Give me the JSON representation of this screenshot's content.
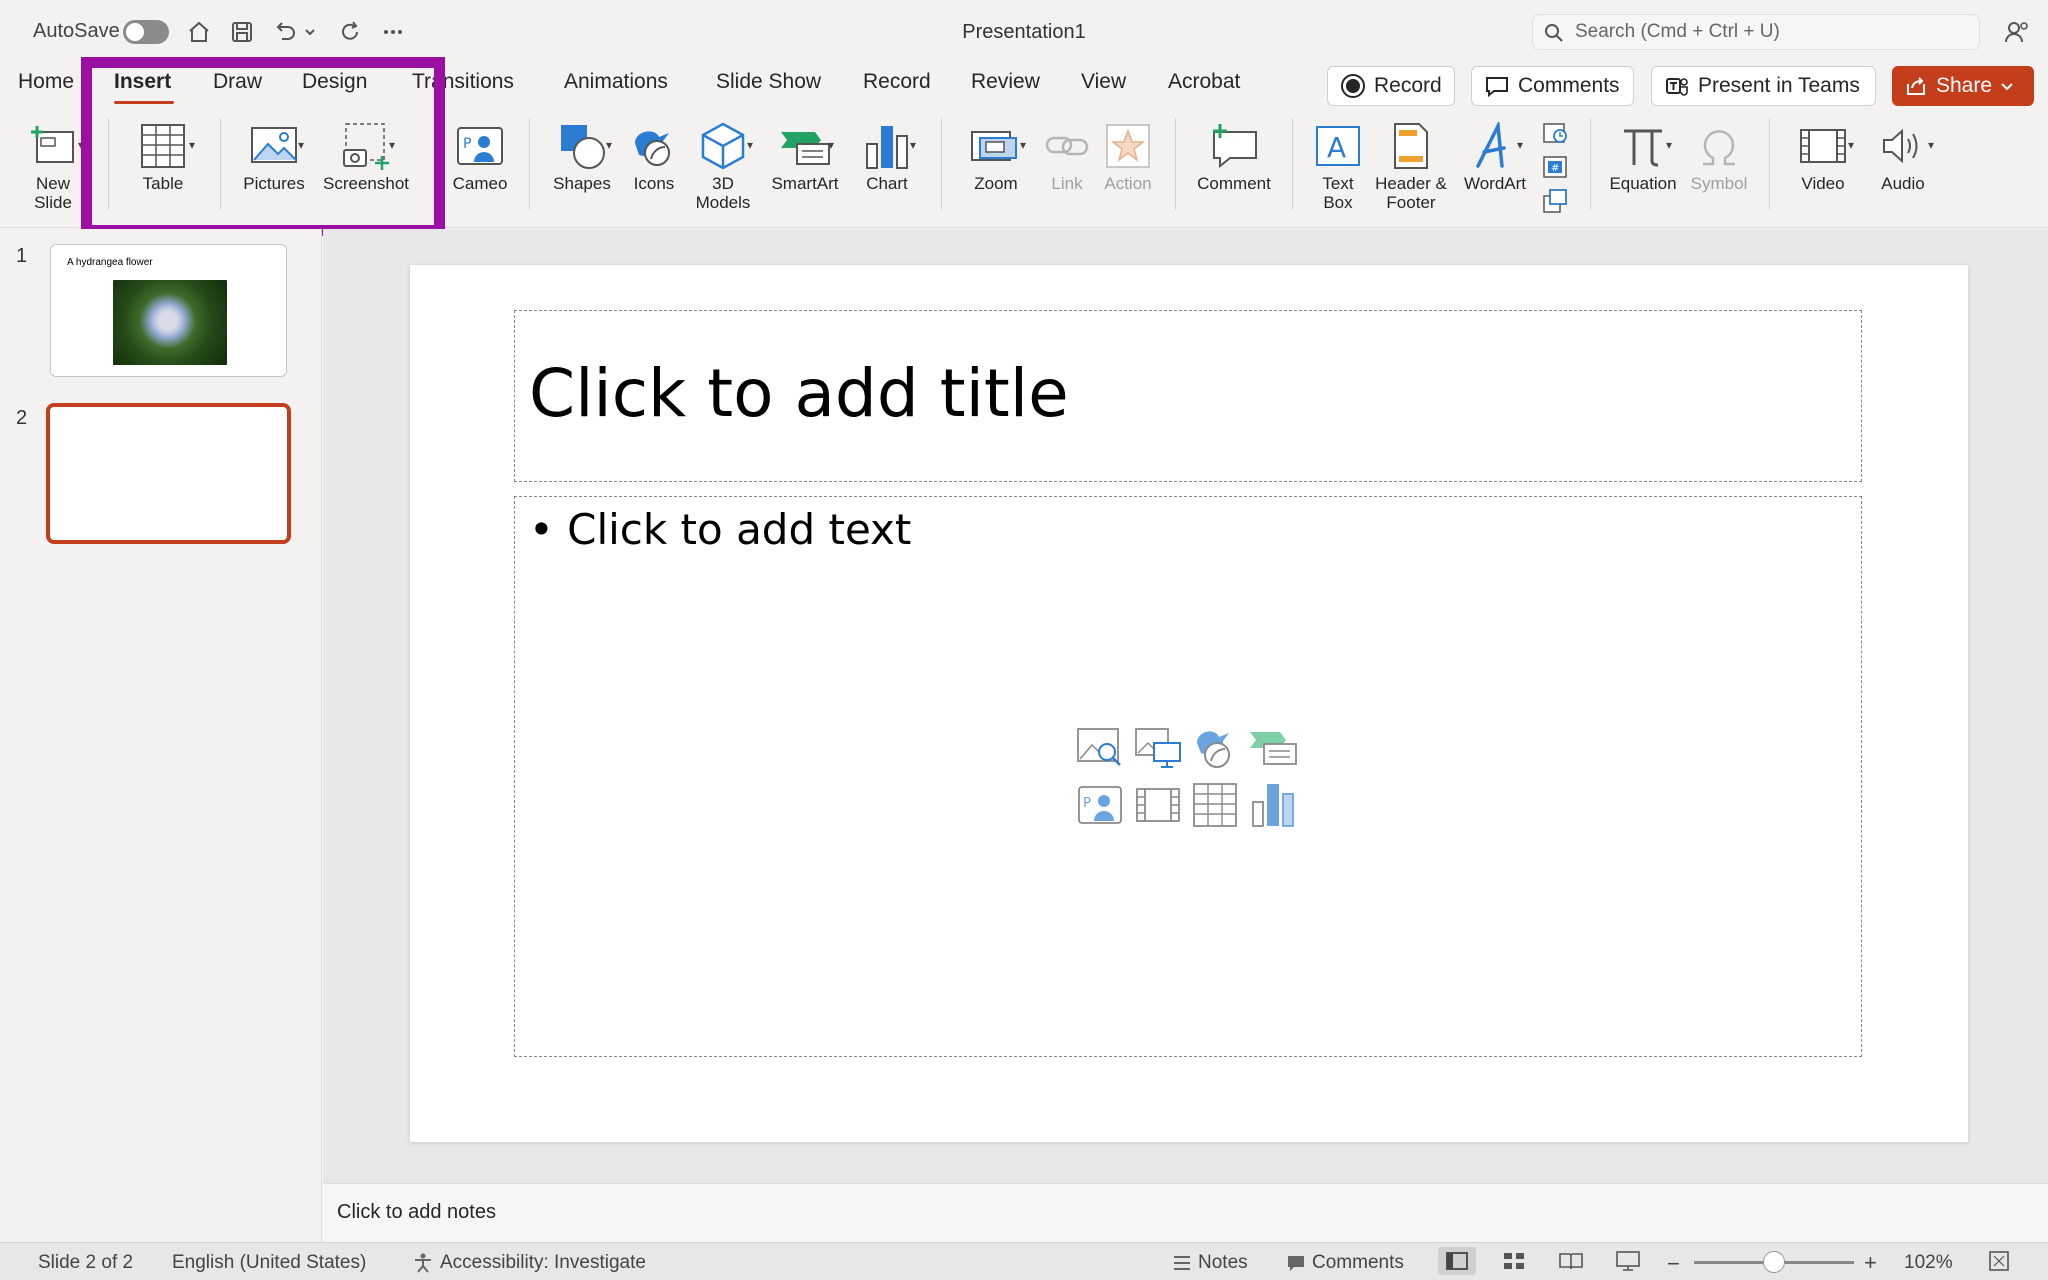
{
  "titlebar": {
    "autosave_label": "AutoSave",
    "doc_title": "Presentation1",
    "search_placeholder": "Search (Cmd + Ctrl + U)"
  },
  "tabs": [
    {
      "label": "Home"
    },
    {
      "label": "Insert",
      "active": true
    },
    {
      "label": "Draw"
    },
    {
      "label": "Design"
    },
    {
      "label": "Transitions"
    },
    {
      "label": "Animations"
    },
    {
      "label": "Slide Show"
    },
    {
      "label": "Record"
    },
    {
      "label": "Review"
    },
    {
      "label": "View"
    },
    {
      "label": "Acrobat"
    }
  ],
  "top_buttons": {
    "record": "Record",
    "comments": "Comments",
    "present": "Present in Teams",
    "share": "Share"
  },
  "ribbon": {
    "new_slide": "New\nSlide",
    "table": "Table",
    "pictures": "Pictures",
    "screenshot": "Screenshot",
    "cameo": "Cameo",
    "shapes": "Shapes",
    "icons": "Icons",
    "models_3d": "3D\nModels",
    "smartart": "SmartArt",
    "chart": "Chart",
    "zoom": "Zoom",
    "link": "Link",
    "action": "Action",
    "comment": "Comment",
    "text_box": "Text\nBox",
    "header_footer": "Header &\nFooter",
    "wordart": "WordArt",
    "equation": "Equation",
    "symbol": "Symbol",
    "video": "Video",
    "audio": "Audio"
  },
  "thumbnails": [
    {
      "number": "1",
      "title": "A hydrangea flower"
    },
    {
      "number": "2"
    }
  ],
  "slide": {
    "title_placeholder": "Click to add title",
    "body_placeholder": "• Click to add text"
  },
  "notes_placeholder": "Click to add notes",
  "status": {
    "slide_info": "Slide 2 of 2",
    "language": "English (United States)",
    "accessibility": "Accessibility: Investigate",
    "notes": "Notes",
    "comments": "Comments",
    "zoom": "102%"
  },
  "colors": {
    "accent": "#c43e1c",
    "highlight_box": "#9b0fa3",
    "icon_blue": "#2b7cd3",
    "icon_green": "#21a366"
  }
}
